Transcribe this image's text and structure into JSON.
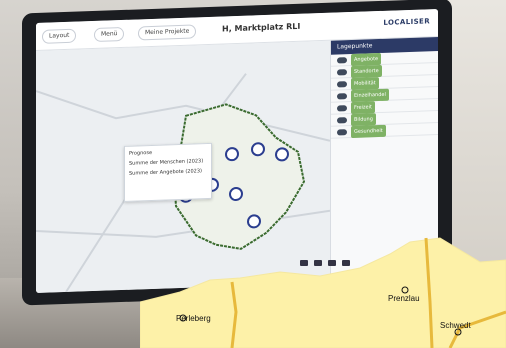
{
  "app": {
    "title": "H, Marktplatz RLI",
    "brand": "LOCALISER",
    "buttons": {
      "layout": "Layout",
      "menu": "Menü",
      "projects": "Meine Projekte"
    }
  },
  "popup": {
    "title": "Prognose",
    "row1": "Summe der Menschen (2023)",
    "row2": "Summe der Angebote (2023)"
  },
  "sidepanel": {
    "header": "Lagepunkte",
    "layers": [
      "Angebote",
      "Standorte",
      "Mobilität",
      "Einzelhandel",
      "Freizeit",
      "Bildung",
      "Gesundheit"
    ]
  },
  "cities": {
    "a": "Perleberg",
    "b": "Prenzlau",
    "c": "Schwedt"
  },
  "colors": {
    "map_fill": "#fdf1a8",
    "road": "#e7b93c",
    "boundary": "#3a6b2f",
    "marker": "#2b3e8f"
  }
}
